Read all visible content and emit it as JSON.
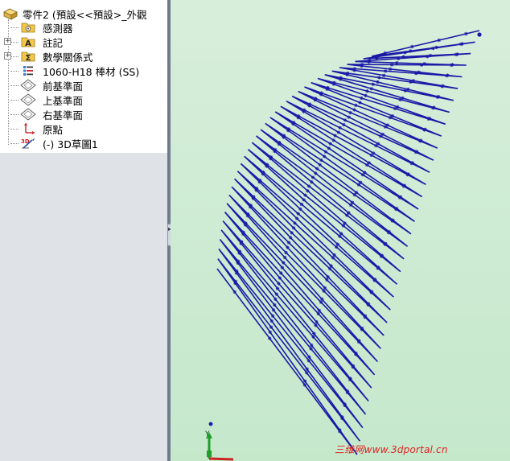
{
  "tree": {
    "root_label": "零件2 (預設<<預設>_外觀",
    "items": [
      {
        "label": "感測器",
        "icon": "sensor-folder-icon",
        "expander": ""
      },
      {
        "label": "註記",
        "icon": "annotation-folder-icon",
        "expander": "+"
      },
      {
        "label": "數學關係式",
        "icon": "equations-folder-icon",
        "expander": "+"
      },
      {
        "label": "1060-H18 棒材 (SS)",
        "icon": "material-icon",
        "expander": ""
      },
      {
        "label": "前基準面",
        "icon": "plane-icon",
        "expander": ""
      },
      {
        "label": "上基準面",
        "icon": "plane-icon",
        "expander": ""
      },
      {
        "label": "右基準面",
        "icon": "plane-icon",
        "expander": ""
      },
      {
        "label": "原點",
        "icon": "origin-icon",
        "expander": ""
      },
      {
        "label": "(-) 3D草圖1",
        "icon": "3d-sketch-icon",
        "expander": ""
      }
    ]
  },
  "splitter": {
    "handle_glyph": "▸▸▸"
  },
  "triad": {
    "y_label": "Y"
  },
  "watermark": {
    "text": "三维网www.3dportal.cn"
  },
  "colors": {
    "sketch": "#1a1aa8",
    "viewport_bg": "#c8eacd",
    "watermark": "#e32222",
    "folder": "#f3c84a"
  }
}
